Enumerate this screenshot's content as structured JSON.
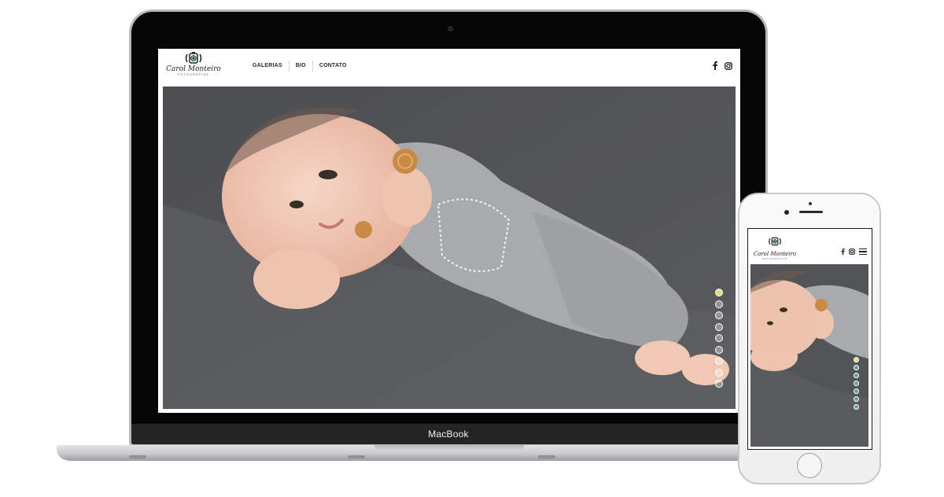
{
  "device": {
    "laptop_label": "MacBook"
  },
  "site": {
    "logo": {
      "name": "Carol Monteiro",
      "tagline": "FOTOGRAFIAS",
      "icon": "camera-icon"
    },
    "nav": [
      {
        "label": "GALERIAS"
      },
      {
        "label": "BIO"
      },
      {
        "label": "CONTATO"
      }
    ],
    "social": [
      {
        "icon": "facebook-icon"
      },
      {
        "icon": "instagram-icon"
      }
    ],
    "slider": {
      "slide_count": 9,
      "active_slide": 1,
      "image": "newborn-baby-gray-romper-photo"
    }
  },
  "mobile": {
    "menu_icon": "hamburger-icon",
    "slide_count": 7,
    "active_slide": 1
  },
  "colors": {
    "active_dot": "#e8dc78",
    "backdrop": "#56575b",
    "romper": "#a8abae",
    "skin": "#f0c8b4",
    "button": "#c98a45"
  }
}
